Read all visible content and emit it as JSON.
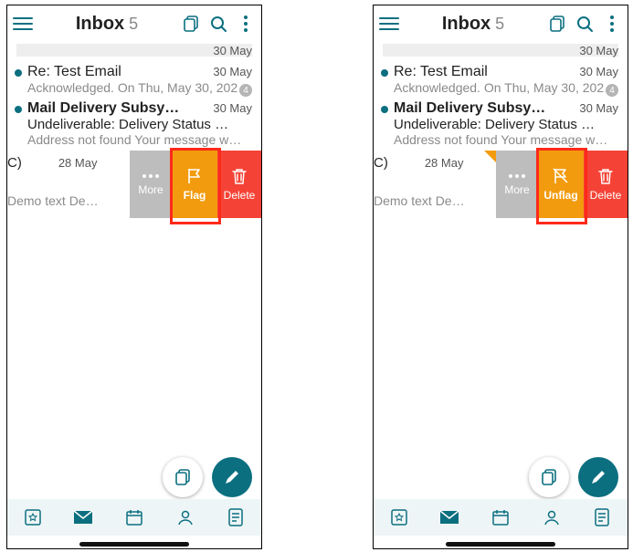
{
  "header": {
    "title": "Inbox",
    "count": "5"
  },
  "rows": {
    "r0": {
      "date": "30 May"
    },
    "r1": {
      "sender": "Re: Test Email",
      "date": "30 May",
      "subject": "Acknowledged. On Thu, May 30, 202…",
      "badge": "4"
    },
    "r2": {
      "sender": "Mail Delivery Subsy…",
      "date": "30 May",
      "subject": "Undeliverable: Delivery Status N…",
      "preview": "Address not found Your message w…"
    },
    "r3": {
      "sender_tail": "C)",
      "date": "28 May",
      "preview": "Demo text De…"
    }
  },
  "actions": {
    "more": "More",
    "flag": "Flag",
    "unflag": "Unflag",
    "delete": "Delete"
  },
  "icons": {
    "menu": "menu-icon",
    "copy": "copy-icon",
    "search": "search-icon",
    "more_vert": "more-vert-icon",
    "flag": "flag-icon",
    "flag_slash": "flag-slash-icon",
    "trash": "trash-icon",
    "dots": "dots-icon",
    "stack": "stack-icon",
    "pencil": "pencil-icon",
    "star_cal": "favorites-icon",
    "mail": "mail-icon",
    "calendar": "calendar-icon",
    "contact": "contact-icon",
    "note": "note-icon"
  }
}
